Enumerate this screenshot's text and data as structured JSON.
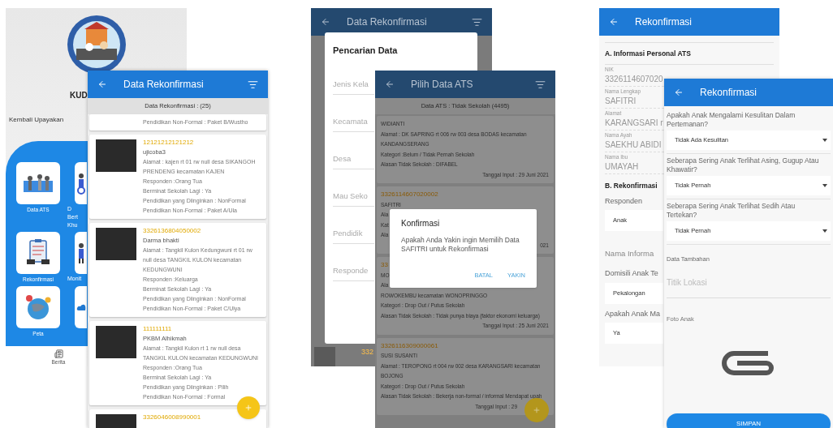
{
  "home_screen": {
    "title": "KUD",
    "subtitle": "Kembali Upayakan",
    "tiles": [
      {
        "lines": [
          "Data ATS"
        ]
      },
      {
        "lines": [
          "D",
          "Bert",
          "Khu"
        ]
      },
      {
        "lines": [
          "Rekonfirmasi"
        ]
      },
      {
        "lines": [
          "Monit"
        ]
      },
      {
        "lines": [
          "Peta"
        ]
      }
    ],
    "nav_label": "Berita"
  },
  "rekonfirmasi_list": {
    "title": "Data Rekonfirmasi",
    "count_label": "Data Rekonfirmasi : (25)",
    "cards": [
      {
        "details": [
          "Pendidikan Non-Formal : Paket B/Wustho"
        ]
      },
      {
        "id": "12121212121212",
        "name": "ujicoba3",
        "details": [
          "Alamat : kajen rt 01 rw null desa SIKANGOH PRENDENG kecamatan KAJEN",
          "Responden :Orang Tua",
          "Berminat Sekolah Lagi : Ya",
          "Pendidikan yang Diinginkan : NonFormal",
          "Pendidikan Non-Formal : Paket A/Ula"
        ]
      },
      {
        "id": "3326136804050002",
        "name": "Darma bhakti",
        "details": [
          "Alamat : Tangkil Kulon Kedungwuni rt 01 rw null desa TANGKIL KULON kecamatan KEDUNGWUNI",
          "Responden :Keluarga",
          "Berminat Sekolah Lagi : Ya",
          "Pendidikan yang Diinginkan : NonFormal",
          "Pendidikan Non-Formal : Paket C/Ulya"
        ]
      },
      {
        "id": "111111111",
        "name": "PKBM Alhikmah",
        "details": [
          "Alamat : Tangkil Kulon rt 1 rw null desa TANGKIL KULON kecamatan KEDUNGWUNI",
          "Responden :Orang Tua",
          "Berminat Sekolah Lagi : Ya",
          "Pendidikan yang Diinginkan : Pilih",
          "Pendidikan Non-Formal : Formal"
        ]
      },
      {
        "id": "3326046008990001"
      }
    ]
  },
  "search_screen": {
    "title": "Data Rekonfirmasi",
    "dialog_title": "Pencarian Data",
    "fields": [
      {
        "placeholder": "Jenis Kela"
      },
      {
        "placeholder": "Kecamata"
      },
      {
        "placeholder": "Desa"
      },
      {
        "placeholder": "Mau Seko"
      },
      {
        "placeholder": "Pendidik"
      },
      {
        "placeholder": "Responde"
      }
    ],
    "peek_id": "332"
  },
  "pilih_screen": {
    "title": "Pilih Data ATS",
    "count_label": "Data ATS : Tidak Sekolah (4495)",
    "cards": [
      {
        "name": "WIDIANTI",
        "details": [
          "Alamat : DK SAPRING rt 006 rw 003 desa BODAS kecamatan KANDANGSERANG",
          "Kategori :Belum / Tidak Pernah Sekolah",
          "Alasan Tidak Sekolah : DIFABEL"
        ],
        "date": "Tanggal Input : 29 Juni 2021"
      },
      {
        "id": "3326114607020002",
        "name": "SAFITRI",
        "details": [
          "Ala",
          "Kat",
          "Ala"
        ],
        "date": "021"
      },
      {
        "id": "33",
        "name": "MO",
        "details": [
          "Ala",
          "ROWOKEMBU kecamatan WONOPRINGGO",
          "Kategori : Drop Out / Putus Sekolah",
          "Alasan Tidak Sekolah : Tidak punya biaya (faktor ekonomi keluarga)"
        ],
        "date": "Tanggal Input : 25 Juni 2021"
      },
      {
        "id": "3326116309000061",
        "name": "SUSI SUSANTI",
        "details": [
          "Alamat : TEROPONG rt 004 rw 002 desa KARANGSARI kecamatan BOJONG",
          "Kategori : Drop Out / Putus Sekolah",
          "Alasan Tidak Sekolah : Bekerja non-formal / informal Mendapat upah"
        ],
        "date": "Tanggal Input : 29"
      }
    ],
    "confirm": {
      "title": "Konfirmasi",
      "message": "Apakah Anda Yakin ingin Memilih Data SAFITRI untuk Rekonfirmasi",
      "buttons": [
        "BATAL",
        "YAKIN"
      ]
    }
  },
  "form_screen": {
    "title": "Rekonfirmasi",
    "section_a": "A. Informasi Personal ATS",
    "personal_fields": [
      {
        "label": "NIK",
        "value": "3326114607020"
      },
      {
        "label": "Nama Lengkap",
        "value": "SAFITRI"
      },
      {
        "label": "Alamat",
        "value": "KARANGSARI r"
      },
      {
        "label": "Nama Ayah",
        "value": "SAEKHU ABIDI"
      },
      {
        "label": "Nama Ibu",
        "value": "UMAYAH"
      }
    ],
    "section_b": "B. Rekonfirmasi",
    "questions": [
      {
        "kind": "select",
        "label": "Responden",
        "value": "Anak"
      },
      {
        "kind": "text",
        "placeholder": "Nama Informa"
      },
      {
        "kind": "select",
        "label": "Domisili Anak Te",
        "value": "Pekalongan"
      },
      {
        "kind": "select",
        "label": "Apakah Anak Ma",
        "value": "Ya"
      }
    ]
  },
  "form_screen_2": {
    "title": "Rekonfirmasi",
    "questions": [
      {
        "question": "Apakah Anak Mengalami Kesulitan Dalam Pertemanan?",
        "answer": "Tidak Ada Kesulitan"
      },
      {
        "question": "Seberapa Sering Anak Terlihat Asing, Gugup Atau Khawatir?",
        "answer": "Tidak Pernah"
      },
      {
        "question": "Seberapa Sering Anak Terlihat Sedih Atau Tertekan?",
        "answer": "Tidak Pernah"
      }
    ],
    "extra_label": "Data Tambahan",
    "location_placeholder": "Titik Lokasi",
    "photo_label": "Foto Anak",
    "save_button": "SIMPAN"
  }
}
